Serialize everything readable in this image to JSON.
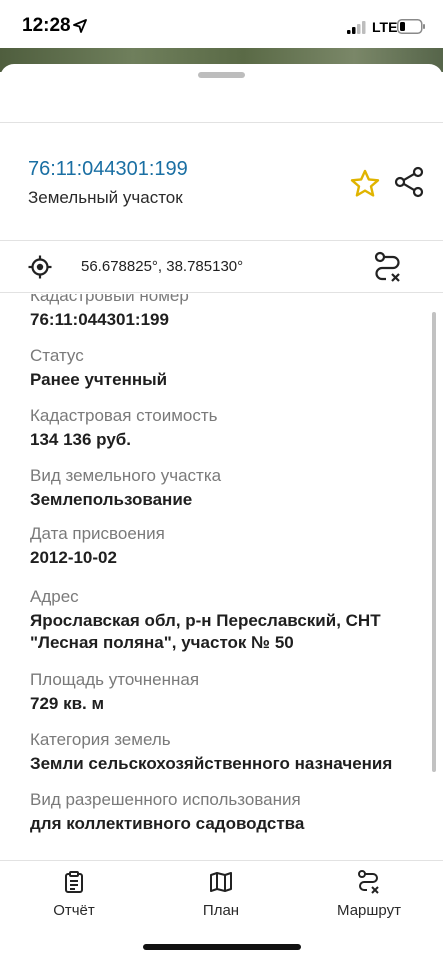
{
  "status_bar": {
    "time": "12:28",
    "network": "LTE"
  },
  "header": {
    "cadastral_number": "76:11:044301:199",
    "object_type": "Земельный участок"
  },
  "coordinates": "56.678825°, 38.785130°",
  "details": [
    {
      "label": "Кадастровый номер",
      "value": "76:11:044301:199"
    },
    {
      "label": "Статус",
      "value": "Ранее учтенный"
    },
    {
      "label": "Кадастровая стоимость",
      "value": "134 136 руб."
    },
    {
      "label": "Вид земельного участка",
      "value": "Землепользование"
    },
    {
      "label": "Дата присвоения",
      "value": "2012-10-02"
    },
    {
      "label": "Адрес",
      "value_lines": [
        "Ярославская обл, р-н Переславский, СНТ",
        "\"Лесная поляна\", участок № 50"
      ]
    },
    {
      "label": "Площадь уточненная",
      "value": "729 кв. м"
    },
    {
      "label": "Категория земель",
      "value": "Земли сельскохозяйственного назначения"
    },
    {
      "label": "Вид разрешенного использования",
      "value": "для коллективного садоводства"
    }
  ],
  "bottom_nav": {
    "report": "Отчёт",
    "plan": "План",
    "route": "Маршрут"
  },
  "colors": {
    "accent_link": "#1a6fa3",
    "star": "#e0b400"
  }
}
